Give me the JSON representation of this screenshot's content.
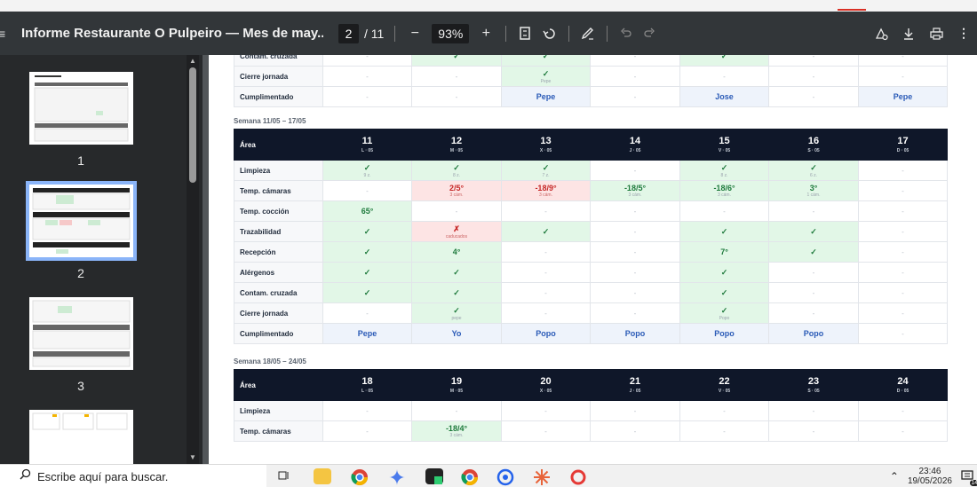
{
  "toolbar": {
    "title": "Informe Restaurante O Pulpeiro — Mes de may...",
    "page_current": "2",
    "page_total": "/ 11",
    "zoom": "93%",
    "zoom_out": "−",
    "zoom_in": "+"
  },
  "thumbnails": [
    {
      "label": "1"
    },
    {
      "label": "2"
    },
    {
      "label": "3"
    }
  ],
  "week_prev_tail": {
    "rows": [
      {
        "area": "Contam. cruzada",
        "cells": [
          [
            "-",
            ""
          ],
          [
            "✓",
            ""
          ],
          [
            "✓",
            ""
          ],
          [
            "-",
            ""
          ],
          [
            "✓",
            ""
          ],
          [
            "-",
            ""
          ],
          [
            "-",
            ""
          ]
        ],
        "kinds": [
          "dash",
          "ok",
          "ok",
          "dash",
          "ok",
          "dash",
          "dash"
        ]
      },
      {
        "area": "Cierre jornada",
        "cells": [
          [
            "-",
            ""
          ],
          [
            "-",
            ""
          ],
          [
            "✓",
            "Pepe"
          ],
          [
            "-",
            ""
          ],
          [
            "-",
            ""
          ],
          [
            "-",
            ""
          ],
          [
            "-",
            ""
          ]
        ],
        "kinds": [
          "dash",
          "dash",
          "ok",
          "dash",
          "dash",
          "dash",
          "dash"
        ]
      },
      {
        "area": "Cumplimentado",
        "cells": [
          [
            "-",
            ""
          ],
          [
            "-",
            ""
          ],
          [
            "Pepe",
            ""
          ],
          [
            "-",
            ""
          ],
          [
            "Jose",
            ""
          ],
          [
            "-",
            ""
          ],
          [
            "Pepe",
            ""
          ]
        ],
        "kinds": [
          "dash",
          "dash",
          "blue",
          "dash",
          "blue",
          "dash",
          "blue"
        ]
      }
    ]
  },
  "week2": {
    "label": "Semana 11/05 – 17/05",
    "header_area": "Área",
    "days": [
      {
        "num": "11",
        "sub": "L · 05"
      },
      {
        "num": "12",
        "sub": "M · 05"
      },
      {
        "num": "13",
        "sub": "X · 05"
      },
      {
        "num": "14",
        "sub": "J · 05"
      },
      {
        "num": "15",
        "sub": "V · 05"
      },
      {
        "num": "16",
        "sub": "S · 05"
      },
      {
        "num": "17",
        "sub": "D · 05"
      }
    ],
    "rows": [
      {
        "area": "Limpieza",
        "cells": [
          [
            "✓",
            "9 z."
          ],
          [
            "✓",
            "8 z."
          ],
          [
            "✓",
            "7 z."
          ],
          [
            "-",
            ""
          ],
          [
            "✓",
            "8 z."
          ],
          [
            "✓",
            "6 z."
          ],
          [
            "-",
            ""
          ]
        ],
        "kinds": [
          "ok",
          "ok",
          "ok",
          "dash",
          "ok",
          "ok",
          "dash"
        ]
      },
      {
        "area": "Temp. cámaras",
        "cells": [
          [
            "-",
            ""
          ],
          [
            "2/5°",
            "3 cám."
          ],
          [
            "-18/9°",
            "3 cám."
          ],
          [
            "-18/5°",
            "3 cám."
          ],
          [
            "-18/6°",
            "3 cám."
          ],
          [
            "3°",
            "1 cám."
          ],
          [
            "-",
            ""
          ]
        ],
        "kinds": [
          "dash",
          "bad",
          "bad",
          "ok",
          "ok",
          "ok",
          "dash"
        ]
      },
      {
        "area": "Temp. cocción",
        "cells": [
          [
            "65°",
            ""
          ],
          [
            "-",
            ""
          ],
          [
            "-",
            ""
          ],
          [
            "-",
            ""
          ],
          [
            "-",
            ""
          ],
          [
            "-",
            ""
          ],
          [
            "-",
            ""
          ]
        ],
        "kinds": [
          "ok",
          "dash",
          "dash",
          "dash",
          "dash",
          "dash",
          "dash"
        ]
      },
      {
        "area": "Trazabilidad",
        "cells": [
          [
            "✓",
            ""
          ],
          [
            "✗",
            "caducados"
          ],
          [
            "✓",
            ""
          ],
          [
            "-",
            ""
          ],
          [
            "✓",
            ""
          ],
          [
            "✓",
            ""
          ],
          [
            "-",
            ""
          ]
        ],
        "kinds": [
          "ok",
          "bad",
          "ok",
          "dash",
          "ok",
          "ok",
          "dash"
        ]
      },
      {
        "area": "Recepción",
        "cells": [
          [
            "✓",
            ""
          ],
          [
            "4°",
            ""
          ],
          [
            "-",
            ""
          ],
          [
            "-",
            ""
          ],
          [
            "7°",
            ""
          ],
          [
            "✓",
            ""
          ],
          [
            "-",
            ""
          ]
        ],
        "kinds": [
          "ok",
          "ok",
          "dash",
          "dash",
          "ok",
          "ok",
          "dash"
        ]
      },
      {
        "area": "Alérgenos",
        "cells": [
          [
            "✓",
            ""
          ],
          [
            "✓",
            ""
          ],
          [
            "-",
            ""
          ],
          [
            "-",
            ""
          ],
          [
            "✓",
            ""
          ],
          [
            "-",
            ""
          ],
          [
            "-",
            ""
          ]
        ],
        "kinds": [
          "ok",
          "ok",
          "dash",
          "dash",
          "ok",
          "dash",
          "dash"
        ]
      },
      {
        "area": "Contam. cruzada",
        "cells": [
          [
            "✓",
            ""
          ],
          [
            "✓",
            ""
          ],
          [
            "-",
            ""
          ],
          [
            "-",
            ""
          ],
          [
            "✓",
            ""
          ],
          [
            "-",
            ""
          ],
          [
            "-",
            ""
          ]
        ],
        "kinds": [
          "ok",
          "ok",
          "dash",
          "dash",
          "ok",
          "dash",
          "dash"
        ]
      },
      {
        "area": "Cierre jornada",
        "cells": [
          [
            "-",
            ""
          ],
          [
            "✓",
            "pepe"
          ],
          [
            "-",
            ""
          ],
          [
            "-",
            ""
          ],
          [
            "✓",
            "Popo"
          ],
          [
            "-",
            ""
          ],
          [
            "-",
            ""
          ]
        ],
        "kinds": [
          "dash",
          "ok",
          "dash",
          "dash",
          "ok",
          "dash",
          "dash"
        ]
      },
      {
        "area": "Cumplimentado",
        "cells": [
          [
            "Pepe",
            ""
          ],
          [
            "Yo",
            ""
          ],
          [
            "Popo",
            ""
          ],
          [
            "Popo",
            ""
          ],
          [
            "Popo",
            ""
          ],
          [
            "Popo",
            ""
          ],
          [
            "-",
            ""
          ]
        ],
        "kinds": [
          "blue",
          "blue",
          "blue",
          "blue",
          "blue",
          "blue",
          "dash"
        ]
      }
    ]
  },
  "week3": {
    "label": "Semana 18/05 – 24/05",
    "header_area": "Área",
    "days": [
      {
        "num": "18",
        "sub": "L · 05"
      },
      {
        "num": "19",
        "sub": "M · 05"
      },
      {
        "num": "20",
        "sub": "X · 05"
      },
      {
        "num": "21",
        "sub": "J · 05"
      },
      {
        "num": "22",
        "sub": "V · 05"
      },
      {
        "num": "23",
        "sub": "S · 05"
      },
      {
        "num": "24",
        "sub": "D · 05"
      }
    ],
    "rows": [
      {
        "area": "Limpieza",
        "cells": [
          [
            "-",
            ""
          ],
          [
            "-",
            ""
          ],
          [
            "-",
            ""
          ],
          [
            "-",
            ""
          ],
          [
            "-",
            ""
          ],
          [
            "-",
            ""
          ],
          [
            "-",
            ""
          ]
        ],
        "kinds": [
          "dash",
          "dash",
          "dash",
          "dash",
          "dash",
          "dash",
          "dash"
        ]
      },
      {
        "area": "Temp. cámaras",
        "cells": [
          [
            "-",
            ""
          ],
          [
            "-18/4°",
            "3 cám."
          ],
          [
            "-",
            ""
          ],
          [
            "-",
            ""
          ],
          [
            "-",
            ""
          ],
          [
            "-",
            ""
          ],
          [
            "-",
            ""
          ]
        ],
        "kinds": [
          "dash",
          "ok",
          "dash",
          "dash",
          "dash",
          "dash",
          "dash"
        ]
      }
    ]
  },
  "taskbar": {
    "search_placeholder": "Escribe aquí para buscar.",
    "time": "23:46",
    "date": "19/05/2026",
    "notif_count": "14"
  },
  "colors": {
    "ok_bg": "#e2f7e7",
    "bad_bg": "#fde4e4",
    "header_bg": "#0f1729",
    "name_blue": "#2b5bb7"
  }
}
